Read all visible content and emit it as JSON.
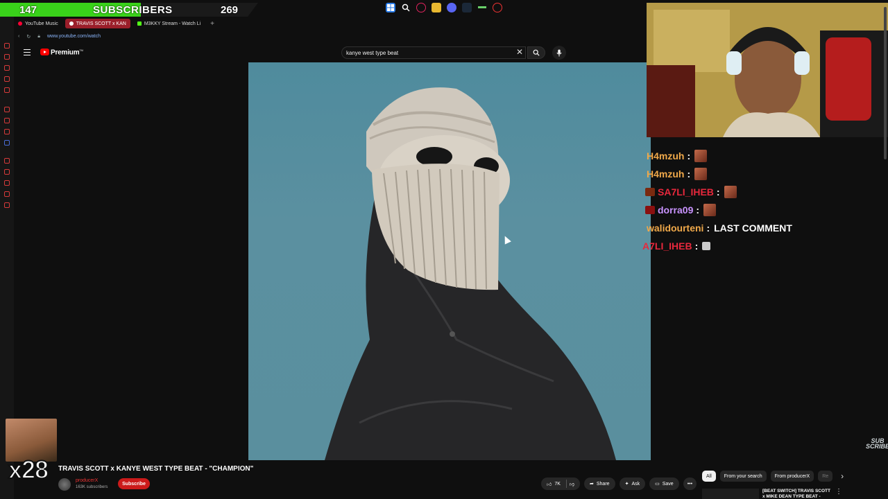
{
  "subscriber_goal": {
    "current": "147",
    "label": "SUBSCRIBERS",
    "goal": "269",
    "progress_fraction": 0.546
  },
  "browser": {
    "tabs": [
      {
        "label": "YouTube Music",
        "active": false
      },
      {
        "label": "TRAVIS SCOTT x KAN",
        "active": true
      },
      {
        "label": "M3KKY Stream - Watch Li",
        "active": false
      }
    ],
    "new_tab": "+",
    "url": "www.youtube.com/watch"
  },
  "youtube": {
    "brand": "Premium",
    "brand_sup": "TM",
    "search_value": "kanye west type beat"
  },
  "chat": [
    {
      "user": "H4mzuh",
      "color": "#f0a94a",
      "message": "",
      "emote": true,
      "badge": false
    },
    {
      "user": "H4mzuh",
      "color": "#f0a94a",
      "message": "",
      "emote": true,
      "badge": false
    },
    {
      "user": "SA7LI_IHEB",
      "color": "#e8283c",
      "message": "",
      "emote": true,
      "badge": true
    },
    {
      "user": "dorra09",
      "color": "#c993ff",
      "message": "",
      "emote": true,
      "badge": true
    },
    {
      "user": "walidourteni",
      "color": "#f0a94a",
      "message": "LAST COMMENT",
      "emote": false,
      "badge": false
    },
    {
      "user": "A7LI_IHEB",
      "color": "#e8283c",
      "message": "",
      "emote": true,
      "badge": false
    }
  ],
  "overlay": {
    "multiplier": "x28",
    "watermark": "SUB SCRIBE"
  },
  "video": {
    "title": "TRAVIS SCOTT x KANYE WEST TYPE BEAT - \"CHAMPION\"",
    "channel": "producerX",
    "subscribers": "163K subscribers",
    "subscribe_label": "Subscribe",
    "likes": "7K",
    "share_label": "Share",
    "ask_label": "Ask",
    "save_label": "Save"
  },
  "recommendations": {
    "chips": [
      "All",
      "From your search",
      "From producerX",
      "Re"
    ],
    "first_title": "[BEAT SWITCH] TRAVIS SCOTT x MIKE DEAN TYPE BEAT -"
  },
  "colors": {
    "goal_fill": "#39d21a",
    "tab_active": "#9b1e2a",
    "subscribe": "#cc1a1a",
    "artwork_bg": "#5a8f9e"
  }
}
